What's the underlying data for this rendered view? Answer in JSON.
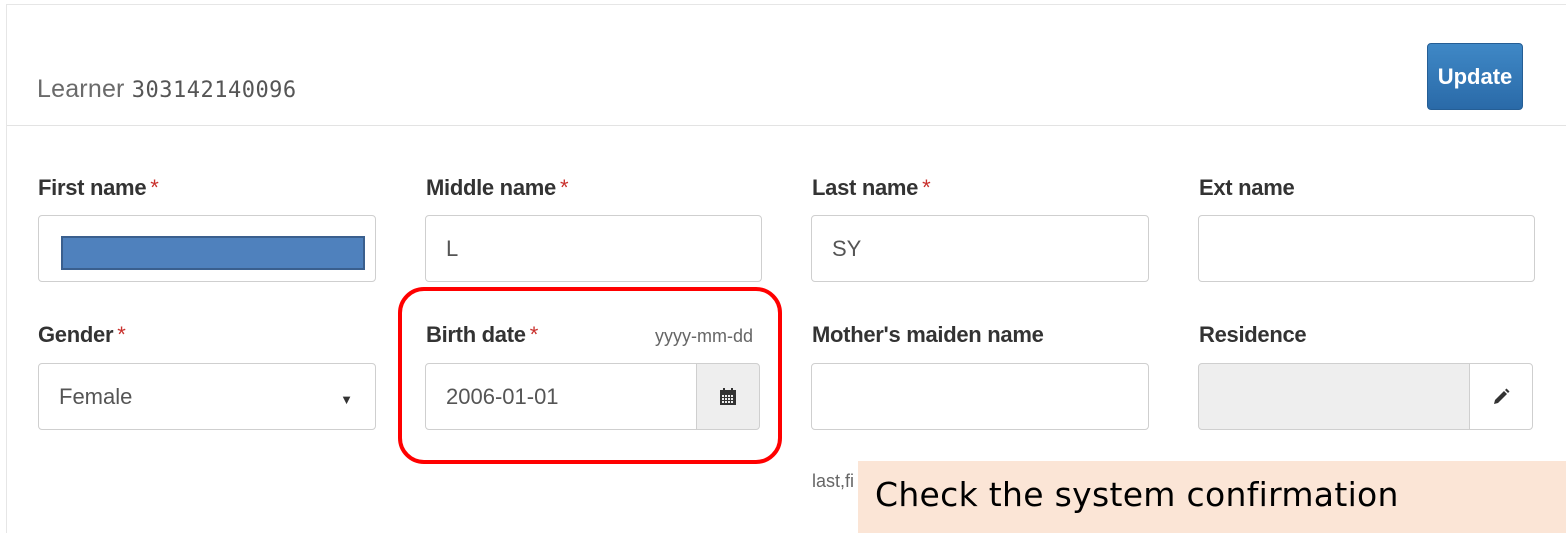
{
  "header": {
    "title_prefix": "Learner",
    "lrn": "303142140096",
    "update_label": "Update"
  },
  "form": {
    "first_name": {
      "label": "First name",
      "required": "*",
      "value": ""
    },
    "middle_name": {
      "label": "Middle name",
      "required": "*",
      "value": "L"
    },
    "last_name": {
      "label": "Last name",
      "required": "*",
      "value": "SY"
    },
    "ext_name": {
      "label": "Ext name",
      "value": ""
    },
    "gender": {
      "label": "Gender",
      "required": "*",
      "value": "Female"
    },
    "birth_date": {
      "label": "Birth date",
      "required": "*",
      "hint": "yyyy-mm-dd",
      "value": "2006-01-01"
    },
    "mothers_maiden_name": {
      "label": "Mother's maiden name",
      "value": "",
      "help": "last,fi"
    },
    "residence": {
      "label": "Residence",
      "value": ""
    }
  },
  "annotation": {
    "callout_text": "Check the system confirmation",
    "highlight_color": "#ff0000",
    "callout_bg": "#fbe5d6"
  },
  "icons": {
    "calendar": "calendar-icon",
    "edit": "pencil-icon",
    "select": "caret-down-icon"
  },
  "colors": {
    "primary": "#337ab7",
    "required": "#c9302c",
    "redaction": "#4f81bd"
  }
}
